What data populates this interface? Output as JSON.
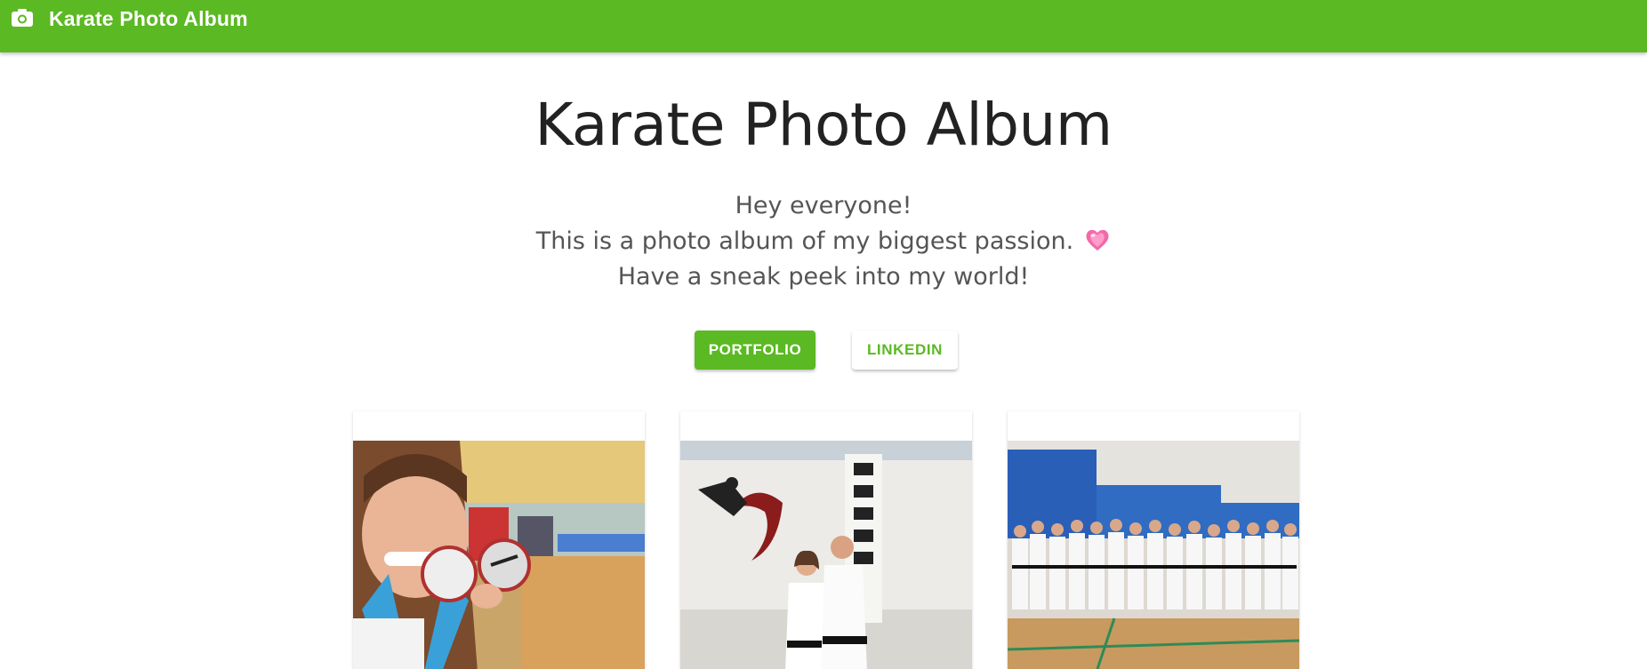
{
  "appbar": {
    "icon": "camera-icon",
    "title": "Karate Photo Album"
  },
  "hero": {
    "title": "Karate Photo Album",
    "lines": [
      "Hey everyone!",
      "This is a photo album of my biggest passion.",
      "Have a sneak peek into my world!"
    ],
    "emoji": "pink-heart-icon",
    "buttons": {
      "portfolio": "PORTFOLIO",
      "linkedin": "LINKEDIN"
    }
  },
  "gallery": {
    "cards": [
      {
        "image": "karate-medal-selfie"
      },
      {
        "image": "dojo-couple-with-banner"
      },
      {
        "image": "karate-group-photo"
      }
    ]
  },
  "colors": {
    "brand": "#5bb923",
    "text_dark": "#222222",
    "text_muted": "#555555"
  }
}
